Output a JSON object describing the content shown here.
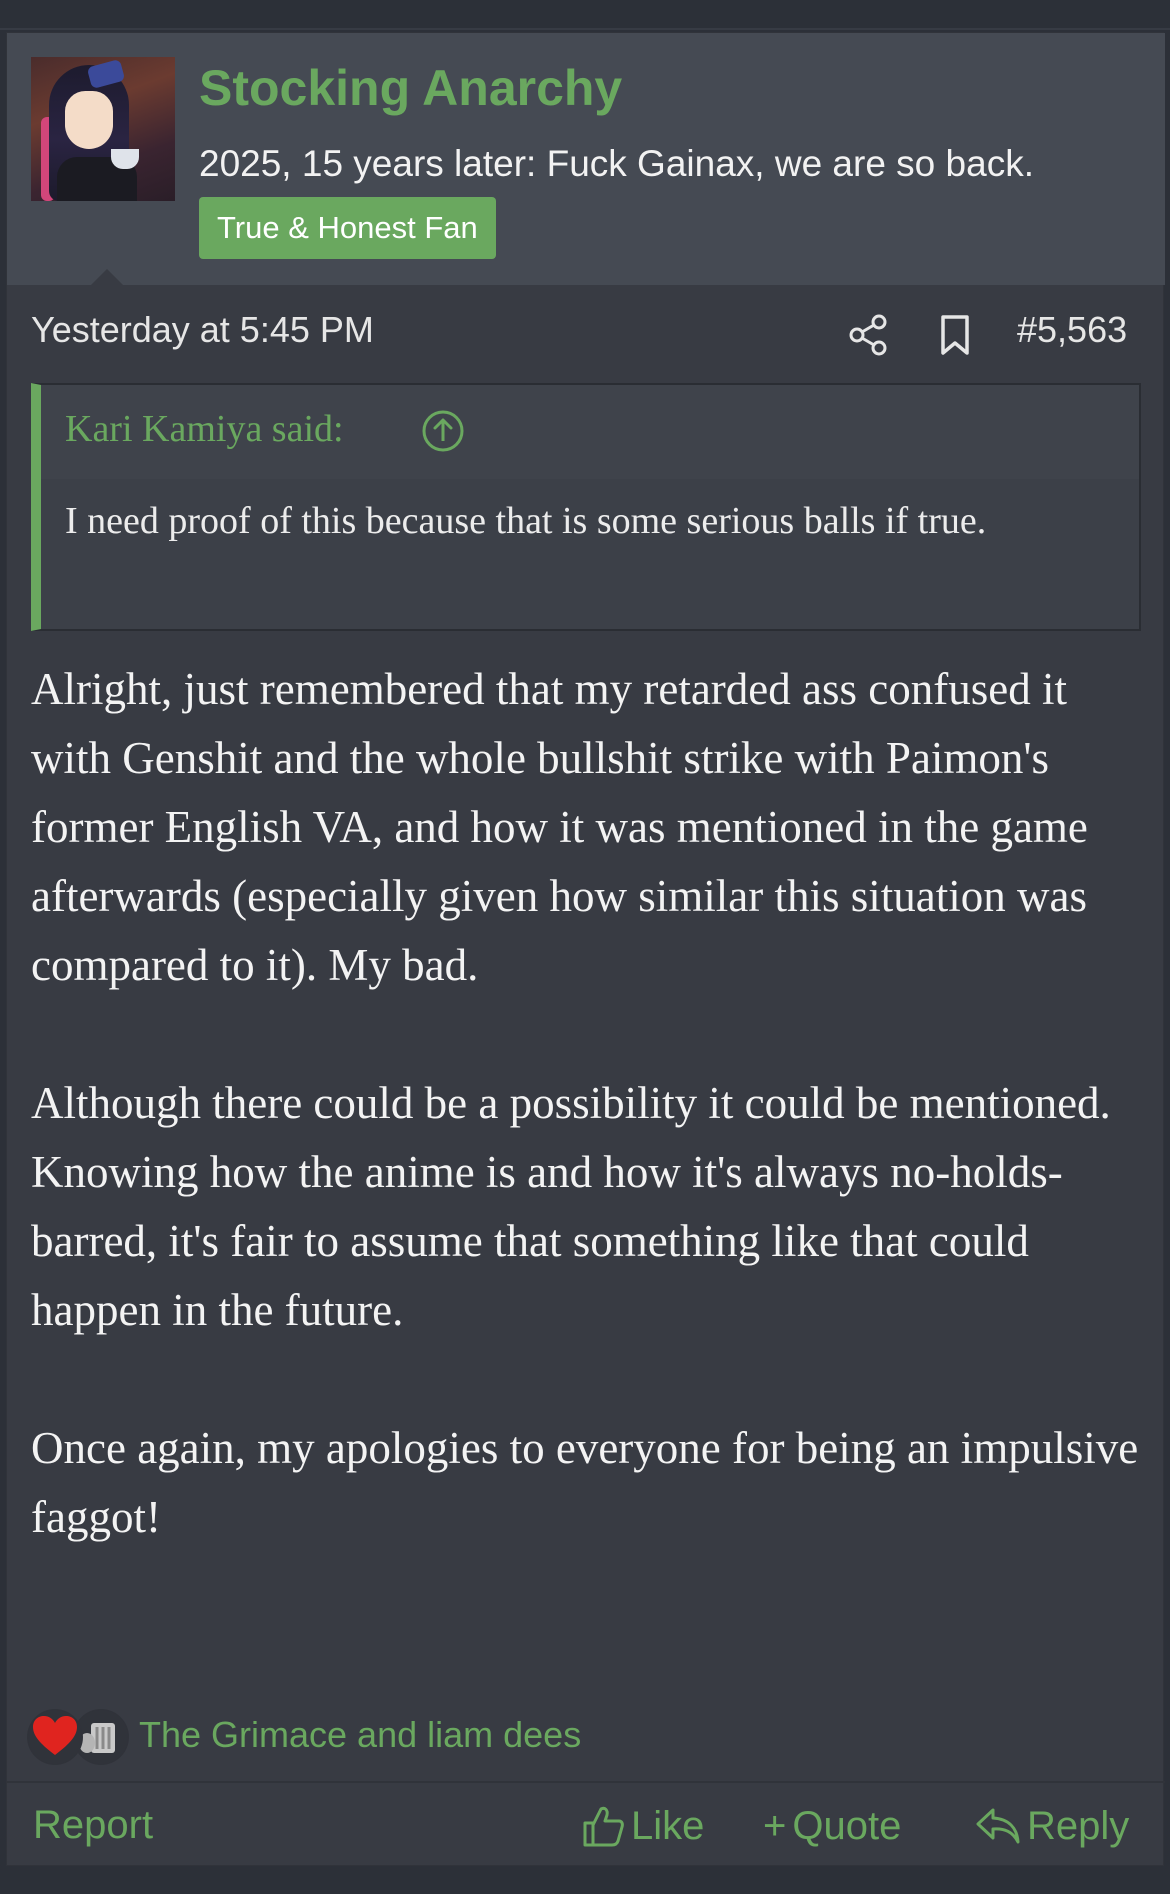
{
  "post": {
    "username": "Stocking Anarchy",
    "user_title": "2025, 15 years later: Fuck Gainax, we are so back.",
    "user_badge": "True & Honest Fan",
    "timestamp": "Yesterday at 5:45 PM",
    "post_number": "#5,563",
    "quote": {
      "author": "Kari Kamiya said:",
      "text": "I need proof of this because that is some serious balls if true."
    },
    "message": [
      "Alright, just remembered that my retarded ass confused it with Genshit and the whole bullshit strike with Paimon's former English VA, and how it was mentioned in the game afterwards (especially given how similar this situation was compared to it). My bad.",
      "Although there could be a possibility it could be mentioned. Knowing how the anime is and how it's always no-holds-barred, it's fair to assume that something like that could happen in the future.",
      "Once again, my apologies to everyone for being an impulsive faggot!"
    ],
    "reactions": {
      "icons": [
        "heart-icon",
        "grimace-icon"
      ],
      "users_text": "The Grimace and liam dees"
    },
    "actions": {
      "report": "Report",
      "like": "Like",
      "quote": "Quote",
      "reply": "Reply"
    }
  },
  "colors": {
    "accent": "#6aa85f",
    "header_bg": "#454a53",
    "post_bg": "#383b43",
    "page_bg": "#2c3038"
  }
}
